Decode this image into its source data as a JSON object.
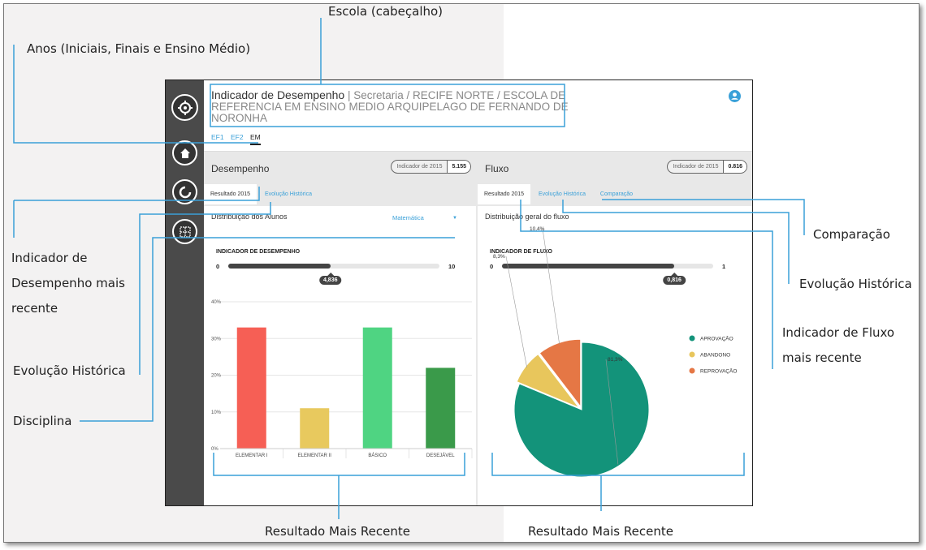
{
  "colors": {
    "accent": "#3aa0d8",
    "sidebar": "#4a4a4a",
    "elementar1": "#f65f55",
    "elementar2": "#e8c95e",
    "basico": "#4fd482",
    "desejavel": "#3a9a4a",
    "aprovacao": "#13937a",
    "abandono": "#e8c65c",
    "reprovacao": "#e57745"
  },
  "annotations": {
    "escola": "Escola (cabeçalho)",
    "anos": "Anos (Iniciais, Finais e Ensino Médio)",
    "indicador_desempenho": "Indicador de Desempenho mais recente",
    "evolucao_left": "Evolução Histórica",
    "disciplina": "Disciplina",
    "resultado_left": "Resultado Mais Recente",
    "resultado_right": "Resultado Mais Recente",
    "comparacao": "Comparação",
    "evolucao_right": "Evolução Histórica",
    "indicador_fluxo": "Indicador de Fluxo mais recente"
  },
  "header": {
    "title_main": "Indicador de Desempenho",
    "title_path": "| Secretaria / RECIFE NORTE / ESCOLA DE REFERENCIA EM ENSINO MEDIO ARQUIPELAGO DE FERNANDO DE NORONHA",
    "user_icon": "user-icon",
    "year_tabs": [
      "EF1",
      "EF2",
      "EM"
    ],
    "active_year": "EM"
  },
  "sidebar": {
    "icons": [
      "logo-icon",
      "home-icon",
      "refresh-icon",
      "grid-icon"
    ]
  },
  "desempenho": {
    "title": "Desempenho",
    "indicator_label": "Indicador de 2015",
    "indicator_value": "5.155",
    "tabs": [
      "Resultado 2015",
      "Evolução Histórica"
    ],
    "subtitle": "Distribuição dos Alunos",
    "discipline": "Matemática",
    "bar_head": "INDICADOR DE DESEMPENHO",
    "bar_min": "0",
    "bar_max": "10",
    "bar_value": "4,836",
    "bar_fraction": 0.4836
  },
  "fluxo": {
    "title": "Fluxo",
    "indicator_label": "Indicador de 2015",
    "indicator_value": "0.816",
    "tabs": [
      "Resultado 2015",
      "Evolução Histórica",
      "Comparação"
    ],
    "subtitle": "Distribuição geral do fluxo",
    "bar_head": "INDICADOR DE FLUXO",
    "bar_min": "0",
    "bar_max": "1",
    "bar_value": "0,816",
    "bar_fraction": 0.816
  },
  "chart_data": [
    {
      "type": "bar",
      "categories": [
        "ELEMENTAR I",
        "ELEMENTAR II",
        "BÁSICO",
        "DESEJÁVEL"
      ],
      "values": [
        33,
        11,
        33,
        22
      ],
      "yticks": [
        "0%",
        "10%",
        "20%",
        "30%",
        "40%"
      ],
      "ylim": [
        0,
        40
      ],
      "grid": true
    },
    {
      "type": "pie",
      "labels": [
        "APROVAÇÃO",
        "ABANDONO",
        "REPROVAÇÃO"
      ],
      "values": [
        81.3,
        8.3,
        10.4
      ],
      "value_labels": [
        "81,3%",
        "8,3%",
        "10,4%"
      ],
      "legend": "bottom-right"
    }
  ]
}
